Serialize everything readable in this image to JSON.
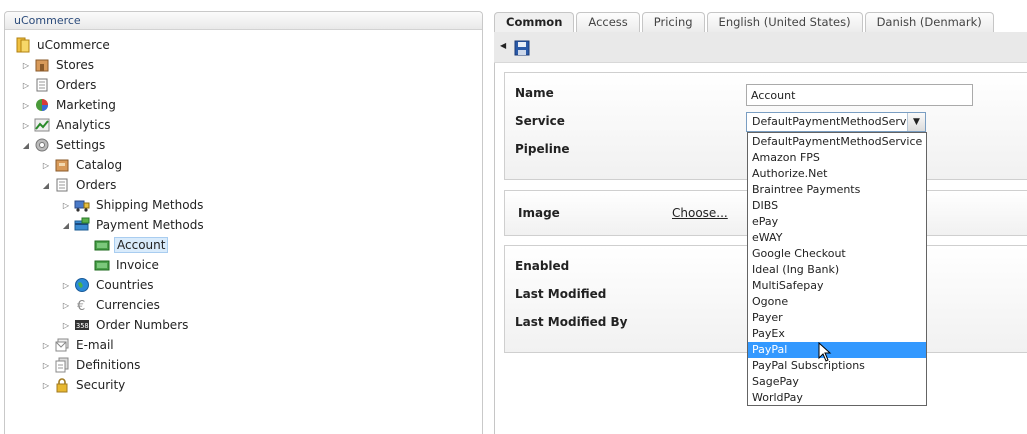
{
  "tree": {
    "header": "uCommerce",
    "nodes": [
      {
        "label": "uCommerce"
      },
      {
        "label": "Stores"
      },
      {
        "label": "Orders"
      },
      {
        "label": "Marketing"
      },
      {
        "label": "Analytics"
      },
      {
        "label": "Settings"
      },
      {
        "label": "Catalog"
      },
      {
        "label": "Orders"
      },
      {
        "label": "Shipping Methods"
      },
      {
        "label": "Payment Methods"
      },
      {
        "label": "Account"
      },
      {
        "label": "Invoice"
      },
      {
        "label": "Countries"
      },
      {
        "label": "Currencies"
      },
      {
        "label": "Order Numbers"
      },
      {
        "label": "E-mail"
      },
      {
        "label": "Definitions"
      },
      {
        "label": "Security"
      }
    ]
  },
  "tabs": [
    "Common",
    "Access",
    "Pricing",
    "English (United States)",
    "Danish (Denmark)"
  ],
  "form": {
    "name_label": "Name",
    "name_value": "Account",
    "service_label": "Service",
    "service_value": "DefaultPaymentMethodService",
    "pipeline_label": "Pipeline",
    "image_label": "Image",
    "choose_link": "Choose...",
    "enabled_label": "Enabled",
    "last_modified_label": "Last Modified",
    "last_modified_by_label": "Last Modified By"
  },
  "dropdown": {
    "options": [
      "DefaultPaymentMethodService",
      "Amazon FPS",
      "Authorize.Net",
      "Braintree Payments",
      "DIBS",
      "ePay",
      "eWAY",
      "Google Checkout",
      "Ideal (Ing Bank)",
      "MultiSafepay",
      "Ogone",
      "Payer",
      "PayEx",
      "PayPal",
      "PayPal Subscriptions",
      "SagePay",
      "WorldPay"
    ],
    "highlighted": "PayPal"
  },
  "colors": {
    "highlight": "#3399ff",
    "selected_node": "#d9ebfb",
    "header_text": "#2a4a7a"
  }
}
